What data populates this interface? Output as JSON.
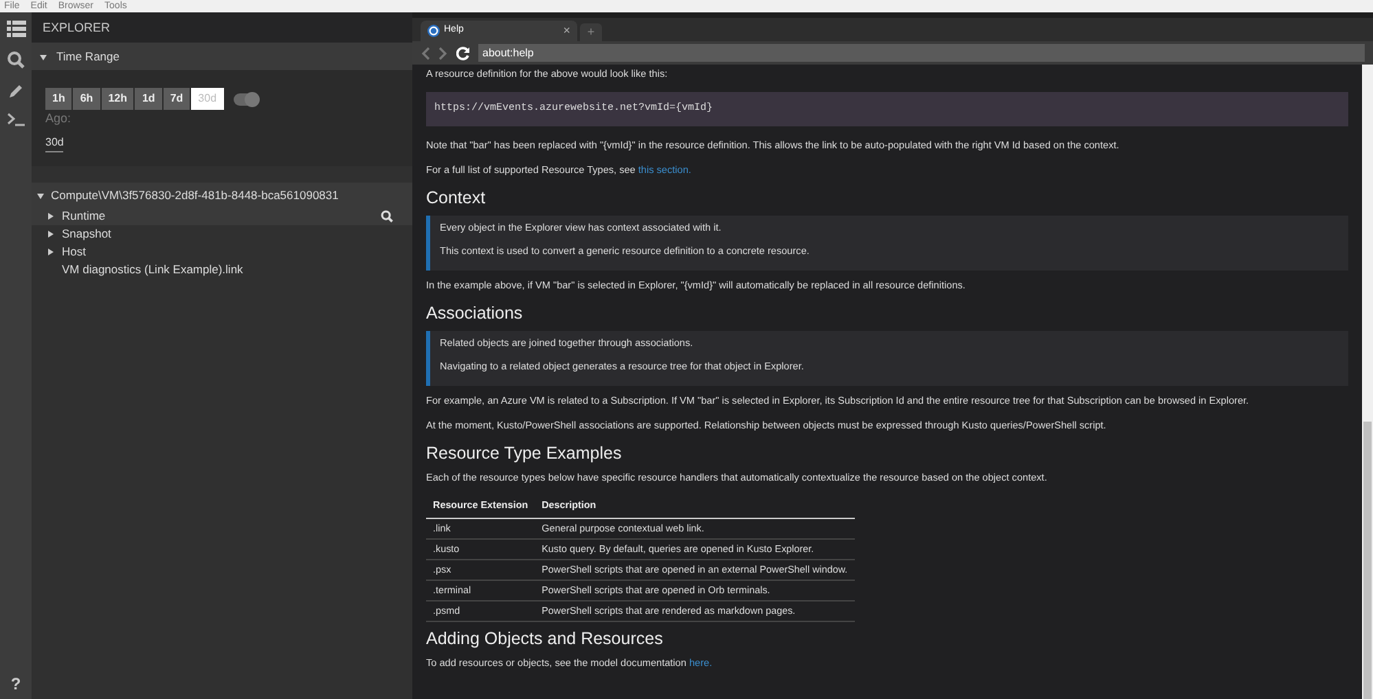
{
  "menu": [
    "File",
    "Edit",
    "Browser",
    "Tools"
  ],
  "activity_bar": [
    {
      "kind": "list",
      "selected": true
    },
    {
      "kind": "search",
      "selected": false
    },
    {
      "kind": "pencil",
      "selected": false
    },
    {
      "kind": "terminal",
      "selected": false
    }
  ],
  "help_button": "?",
  "explorer": {
    "title": "EXPLORER",
    "time_range": {
      "title": "Time Range",
      "expanded": true,
      "ranges": [
        {
          "label": "1h",
          "selected": false
        },
        {
          "label": "6h",
          "selected": false
        },
        {
          "label": "12h",
          "selected": false
        },
        {
          "label": "1d",
          "selected": false
        },
        {
          "label": "7d",
          "selected": false
        },
        {
          "label": "30d",
          "selected": true
        }
      ],
      "toggle_on": true,
      "ago_label": "Ago:",
      "ago_value": "30d"
    },
    "tree": {
      "label": "Compute\\VM\\3f576830-2d8f-481b-8448-bca561090831",
      "expanded": true,
      "children": [
        {
          "label": "Runtime",
          "kind": "folder",
          "expanded": false,
          "selected": true
        },
        {
          "label": "Snapshot",
          "kind": "folder",
          "expanded": false,
          "selected": false
        },
        {
          "label": "Host",
          "kind": "folder",
          "expanded": false,
          "selected": false
        },
        {
          "label": "VM diagnostics (Link Example).link",
          "kind": "file",
          "selected": false
        }
      ]
    }
  },
  "browser": {
    "tabs": [
      {
        "label": "Help",
        "selected": true,
        "close": "×"
      }
    ],
    "new_tab": "+",
    "address": "about:help",
    "content": [
      {
        "kind": "p",
        "text": "A resource definition for the above would look like this:"
      },
      {
        "kind": "code",
        "text": "https://vmEvents.azurewebsite.net?vmId={vmId}"
      },
      {
        "kind": "p",
        "text": "Note that \"bar\" has been replaced with \"{vmId}\" in the resource definition. This allows the link to be auto-populated with the right VM Id based on the context."
      },
      {
        "kind": "p",
        "text": "For a full list of supported Resource Types, see",
        "link": "this section."
      },
      {
        "kind": "h",
        "text": "Context"
      },
      {
        "kind": "quote",
        "lines": [
          "Every object in the Explorer view has context associated with it.",
          "This context is used to convert a generic resource definition to a concrete resource."
        ]
      },
      {
        "kind": "p",
        "text": "In the example above, if VM \"bar\" is selected in Explorer, \"{vmId}\" will automatically be replaced in all resource definitions."
      },
      {
        "kind": "h",
        "text": "Associations"
      },
      {
        "kind": "quote",
        "lines": [
          "Related objects are joined together through associations.",
          "Navigating to a related object generates a resource tree for that object in Explorer."
        ]
      },
      {
        "kind": "p",
        "text": "For example, an Azure VM is related to a Subscription. If VM \"bar\" is selected in Explorer, its Subscription Id and the entire resource tree for that Subscription can be browsed in Explorer."
      },
      {
        "kind": "p",
        "text": "At the moment, Kusto/PowerShell associations are supported. Relationship between objects must be expressed through Kusto queries/PowerShell script."
      },
      {
        "kind": "h",
        "text": "Resource Type Examples"
      },
      {
        "kind": "p",
        "text": "Each of the resource types below have specific resource handlers that automatically contextualize the resource based on the object context."
      },
      {
        "kind": "table",
        "columns": [
          "Resource Extension",
          "Description"
        ],
        "rows": [
          [
            ".link",
            "General purpose contextual web link."
          ],
          [
            ".kusto",
            "Kusto query. By default, queries are opened in Kusto Explorer."
          ],
          [
            ".psx",
            "PowerShell scripts that are opened in an external PowerShell window."
          ],
          [
            ".terminal",
            "PowerShell scripts that are opened in Orb terminals."
          ],
          [
            ".psmd",
            "PowerShell scripts that are rendered as markdown pages."
          ]
        ]
      },
      {
        "kind": "h",
        "text": "Adding Objects and Resources"
      },
      {
        "kind": "p",
        "text": "To add resources or objects, see the model documentation",
        "link": "here."
      }
    ]
  }
}
